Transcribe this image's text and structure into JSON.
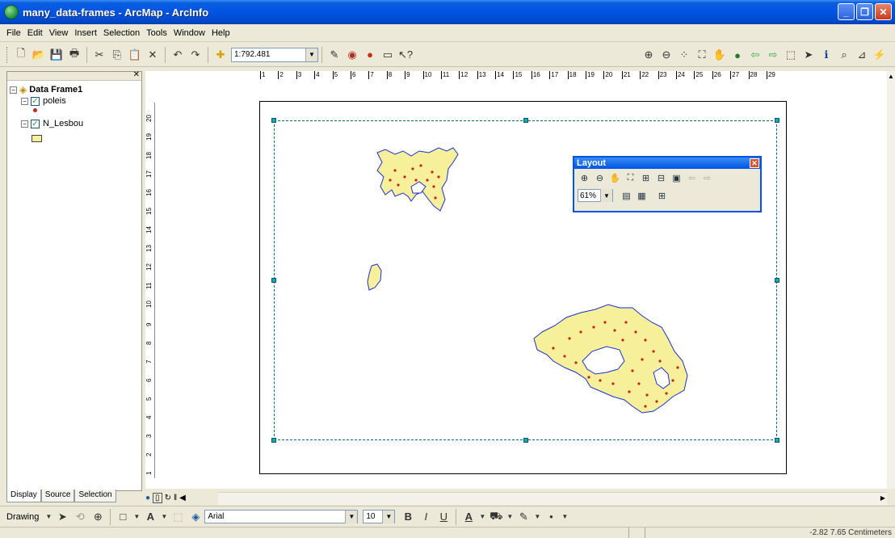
{
  "window": {
    "title": "many_data-frames - ArcMap - ArcInfo"
  },
  "menubar": {
    "items": [
      "File",
      "Edit",
      "View",
      "Insert",
      "Selection",
      "Tools",
      "Window",
      "Help"
    ]
  },
  "toolbar": {
    "scale_value": "1:792.481"
  },
  "toc": {
    "data_frame": "Data Frame1",
    "layers": [
      {
        "name": "poleis",
        "symbol": "point",
        "color": "#b52a23"
      },
      {
        "name": "N_Lesbou",
        "symbol": "polygon",
        "color": "#f7f09a"
      }
    ],
    "tabs": [
      "Display",
      "Source",
      "Selection"
    ]
  },
  "ruler": {
    "top": [
      "1",
      "2",
      "3",
      "4",
      "5",
      "6",
      "7",
      "8",
      "9",
      "10",
      "11",
      "12",
      "13",
      "14",
      "15",
      "16",
      "17",
      "18",
      "19",
      "20",
      "21",
      "22",
      "23",
      "24",
      "25",
      "26",
      "27",
      "28",
      "29"
    ],
    "left": [
      "20",
      "19",
      "18",
      "17",
      "16",
      "15",
      "14",
      "13",
      "12",
      "11",
      "10",
      "9",
      "8",
      "7",
      "6",
      "5",
      "4",
      "3",
      "2",
      "1"
    ]
  },
  "layout_toolbar": {
    "title": "Layout",
    "zoom_value": "61%"
  },
  "drawing": {
    "label": "Drawing",
    "font": "Arial",
    "size": "10"
  },
  "status": {
    "coords": "-2.82  7.65 Centimeters"
  },
  "colors": {
    "land_fill": "#f7f09a",
    "land_outline": "#1b2fd1",
    "points": "#c8201d",
    "frame": "#0b6a75"
  }
}
